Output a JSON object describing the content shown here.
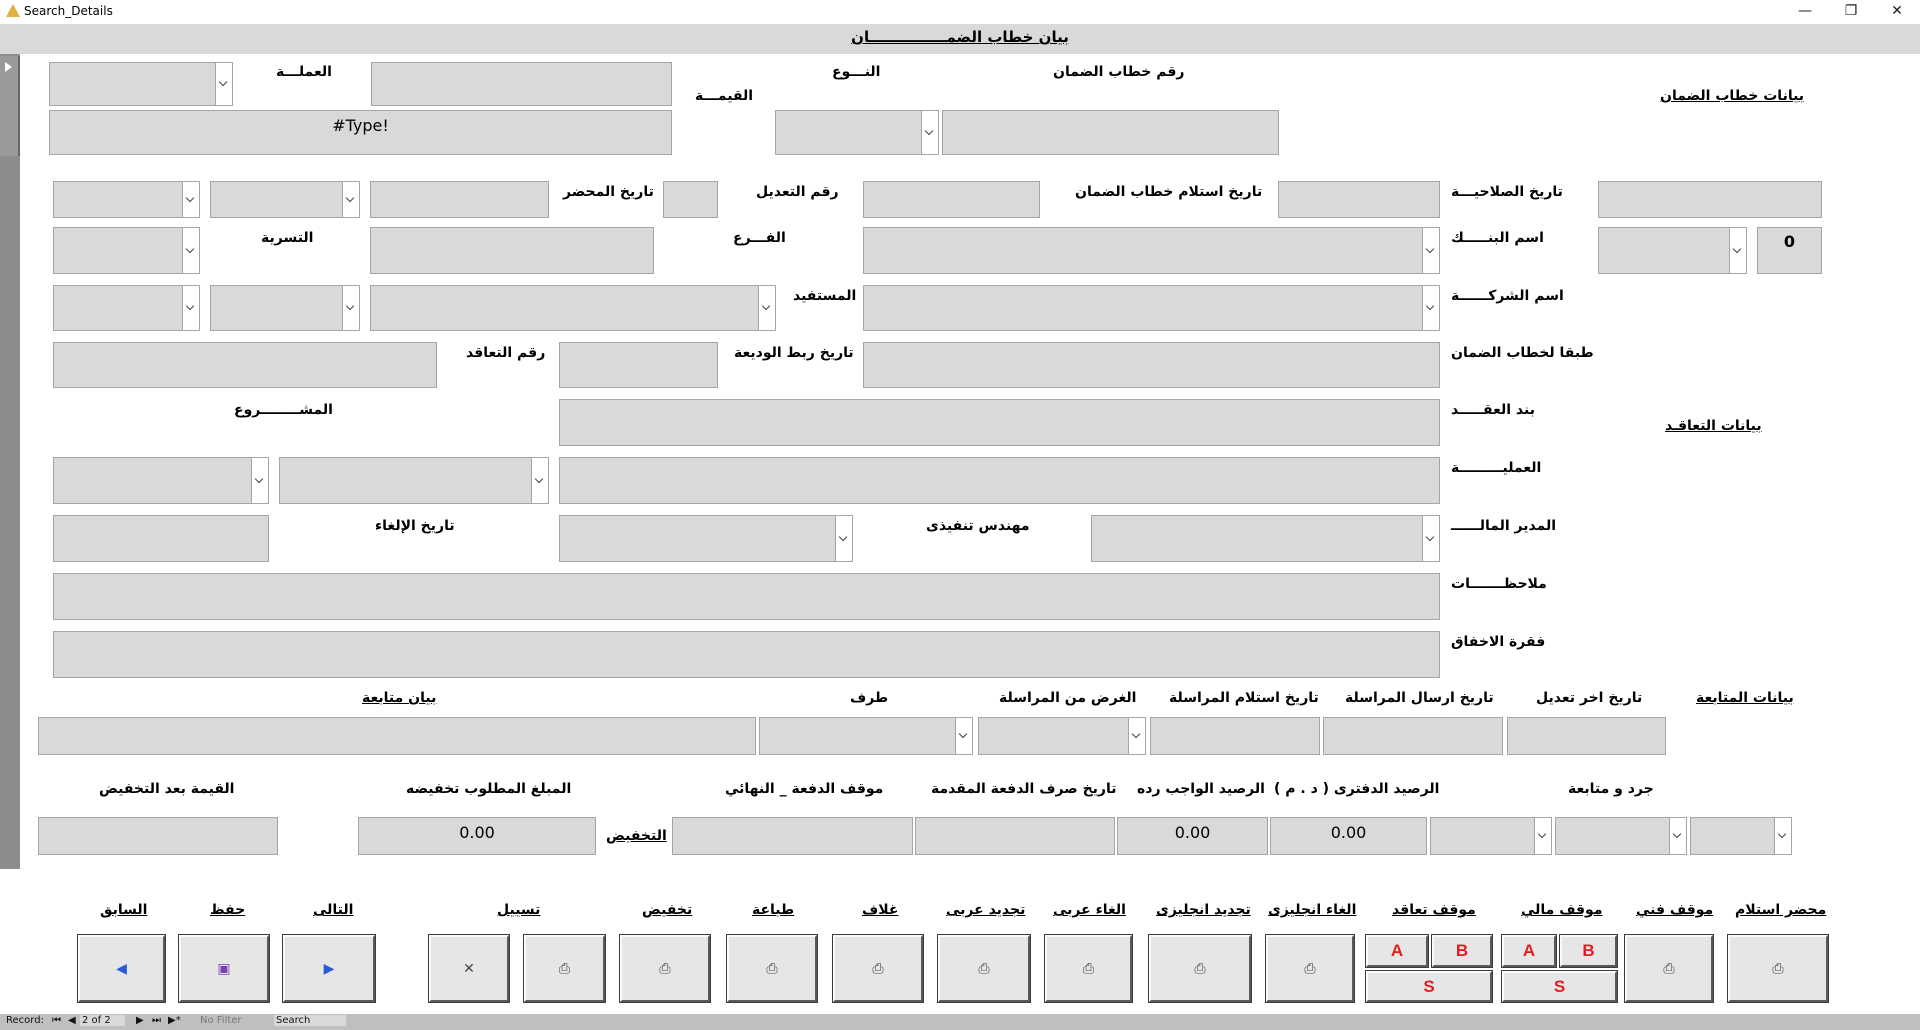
{
  "window": {
    "title": "Search_Details",
    "minimize": "—",
    "restore": "❐",
    "close": "✕"
  },
  "header": {
    "title": "بيان خطاب الضمـــــــــــــــان"
  },
  "sections": {
    "guarantee": "بيانات خطاب الضمان",
    "contract": "بيانات التعاقـد",
    "followup": "بيانات المتابعة",
    "discount": "التخفيض",
    "followup_stmt": "بيان متابعة"
  },
  "labels": {
    "currency": "العملـــة",
    "value": "القيمـــة",
    "type": "النـــوع",
    "guarantee_no": "رقم خطاب الضمان",
    "validity_date": "تاريخ الصلاحيـــة",
    "receipt_date": "تاريخ استلام خطاب الضمان",
    "amend_no": "رقم التعديل",
    "minutes_date": "تاريخ المحضر",
    "bank_name": "اسم البنـــــك",
    "branch": "الفـــرع",
    "settlement": "التسرية",
    "company_name": "اسم الشركــــــة",
    "beneficiary": "المستفيد",
    "per_guarantee": "طبقا لخطاب الضمان",
    "deposit_date": "تاريخ ربط الوديعة",
    "contract_no": "رقم التعاقد",
    "contract_item": "بند العقـــــد",
    "project": "المشــــــــروع",
    "operation": "العمليـــــــــة",
    "fin_manager": "المدير المالــــــ",
    "exec_engineer": "مهندس تنفيذى",
    "cancel_date": "تاريخ الإلغاء",
    "notes": "ملاحظـــــــات",
    "failure_para": "فقرة الاخفاق",
    "last_edit_date": "تاريخ اخر تعديل",
    "send_date": "تاريخ ارسال المراسلة",
    "recv_corr_date": "تاريخ استلام المراسلة",
    "purpose": "الغرض من المراسلة",
    "party": "طرف",
    "inventory": "جرد و متابعة",
    "book_balance": "الرصيد الدفترى ( د . م )",
    "due_balance": "الرصيد الواجب رده",
    "advance_date": "تاريخ صرف  الدفعة المقدمة",
    "final_status": "موقف الدفعة _ النهائي",
    "reduce_amount": "المبلغ المطلوب تخفيضه",
    "value_after": "القيمة بعد التخفيض"
  },
  "values": {
    "type_error": "#Type!",
    "bank_code": "0",
    "book_balance": "0.00",
    "due_balance": "0.00",
    "reduce_amount": "0.00"
  },
  "buttons": {
    "receipt_minutes": "محضر استلام",
    "tech_status": "موقف فني",
    "fin_status": "موقف مالي",
    "contract_status": "موقف تعاقد",
    "cancel_en": "الغاء انجليزى",
    "renew_en": "تجديد انجليزى",
    "cancel_ar": "الغاء عربى",
    "renew_ar": "تجديد عربى",
    "cover": "غلاف",
    "print": "طباعة",
    "reduce": "تخفيض",
    "liquidate": "تسييل",
    "next": "التالى",
    "save": "حفظ",
    "prev": "السابق",
    "a": "A",
    "b": "B",
    "s": "S"
  },
  "status": {
    "record_label": "Record:",
    "position": "2 of 2",
    "filter": "No Filter",
    "search": "Search"
  }
}
